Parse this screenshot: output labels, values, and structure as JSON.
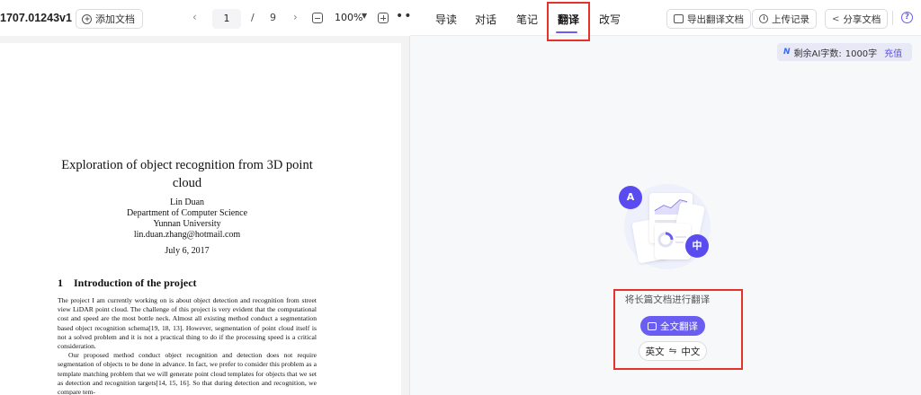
{
  "left_toolbar": {
    "doc_title": "1707.01243v1",
    "add_doc_label": "添加文档",
    "prev": "‹",
    "next": "›",
    "current_page": "1",
    "page_sep": "/",
    "total_pages": "9",
    "zoom": "100%",
    "more": "•••"
  },
  "paper": {
    "title": "Exploration of object recognition from 3D point cloud",
    "authors": [
      "Lin Duan",
      "Department of Computer Science",
      "Yunnan University",
      "lin.duan.zhang@hotmail.com"
    ],
    "date": "July 6, 2017",
    "section_num": "1",
    "section_title": "Introduction of the project",
    "para1": "The project I am currently working on is about object detection and recognition from street view LiDAR point cloud. The challenge of this project is very evident that the computational cost and speed are the most bottle neck. Almost all existing method conduct a segmentation based object recognition schema[19, 18, 13]. However, segmentation of point cloud itself is not a solved problem and it is not a practical thing to do if the processing speed is a critical consideration.",
    "para2": "Our proposed method conduct object recognition and detection does not require segmentation of objects to be done in advance. In fact, we prefer to consider this problem as a template matching problem that we will generate point cloud templates for objects that we set as detection and recognition targets[14, 15, 16]. So that during detection and recognition, we compare tem-"
  },
  "tabs": [
    "导读",
    "对话",
    "笔记",
    "翻译",
    "改写"
  ],
  "active_tab": "翻译",
  "toolbar": {
    "export_label": "导出翻译文档",
    "upload_label": "上传记录",
    "share_label": "分享文档",
    "help": "?"
  },
  "quota": {
    "label": "剩余AI字数:",
    "value": "1000字",
    "recharge": "充值"
  },
  "translate": {
    "badge_en": "A",
    "badge_zh": "中",
    "description": "将长篇文档进行翻译",
    "full_button": "全文翻译",
    "source_lang": "英文",
    "swap": "⇋",
    "target_lang": "中文"
  },
  "colors": {
    "accent": "#6a5df2",
    "highlight": "#e6332a"
  }
}
